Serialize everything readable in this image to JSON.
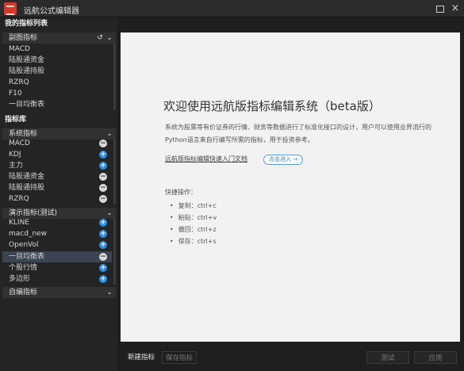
{
  "window": {
    "title": "远航公式编辑器"
  },
  "my_list": {
    "header": "我的指标列表",
    "group": "副图指标",
    "items": [
      {
        "label": "MACD"
      },
      {
        "label": "陆股通资金"
      },
      {
        "label": "陆股通持股"
      },
      {
        "label": "RZRQ"
      },
      {
        "label": "F10"
      },
      {
        "label": "一目均衡表"
      }
    ]
  },
  "library": {
    "header": "指标库",
    "groups": [
      {
        "label": "系统指标",
        "items": [
          {
            "label": "MACD",
            "action": "minus"
          },
          {
            "label": "KDJ",
            "action": "plus"
          },
          {
            "label": "主力",
            "action": "plus"
          },
          {
            "label": "陆股通资金",
            "action": "minus"
          },
          {
            "label": "陆股通持股",
            "action": "minus"
          },
          {
            "label": "RZRQ",
            "action": "minus"
          }
        ]
      },
      {
        "label": "演示指标(测试)",
        "items": [
          {
            "label": "KLINE",
            "action": "plus"
          },
          {
            "label": "macd_new",
            "action": "plus"
          },
          {
            "label": "OpenVol",
            "action": "plus"
          },
          {
            "label": "一目均衡表",
            "action": "minus"
          },
          {
            "label": "个股行情",
            "action": "plus"
          },
          {
            "label": "多边形",
            "action": "plus"
          }
        ]
      },
      {
        "label": "自编指标",
        "items": []
      }
    ]
  },
  "content": {
    "title": "欢迎使用远航版指标编辑系统（beta版）",
    "description": "系统为股票等有价证券的行情、财务等数据进行了标准化接口的设计，用户可以使用业界流行的Python语言来自行编写所需的指标，用于投资参考。",
    "doc_link": "远航版指标编辑快速入门文档",
    "enter_button": "点击进入 →",
    "shortcuts_title": "快捷操作：",
    "shortcuts": [
      "复制：ctrl+c",
      "粘贴：ctrl+v",
      "撤回：ctrl+z",
      "保存：ctrl+s"
    ]
  },
  "footer": {
    "new": "新建指标",
    "save": "保存指标",
    "test": "测试",
    "apply": "应用"
  },
  "icons": {
    "window_icons": [
      "maximize-icon",
      "close-icon"
    ],
    "group_icons": [
      "refresh-icon",
      "chevron-down-icon"
    ],
    "item_icons": [
      "plus-circle-icon",
      "minus-circle-icon"
    ]
  },
  "colors": {
    "accent": "#2b8ee0",
    "selected_row": "#3c4452",
    "logo": "#d8362a"
  }
}
